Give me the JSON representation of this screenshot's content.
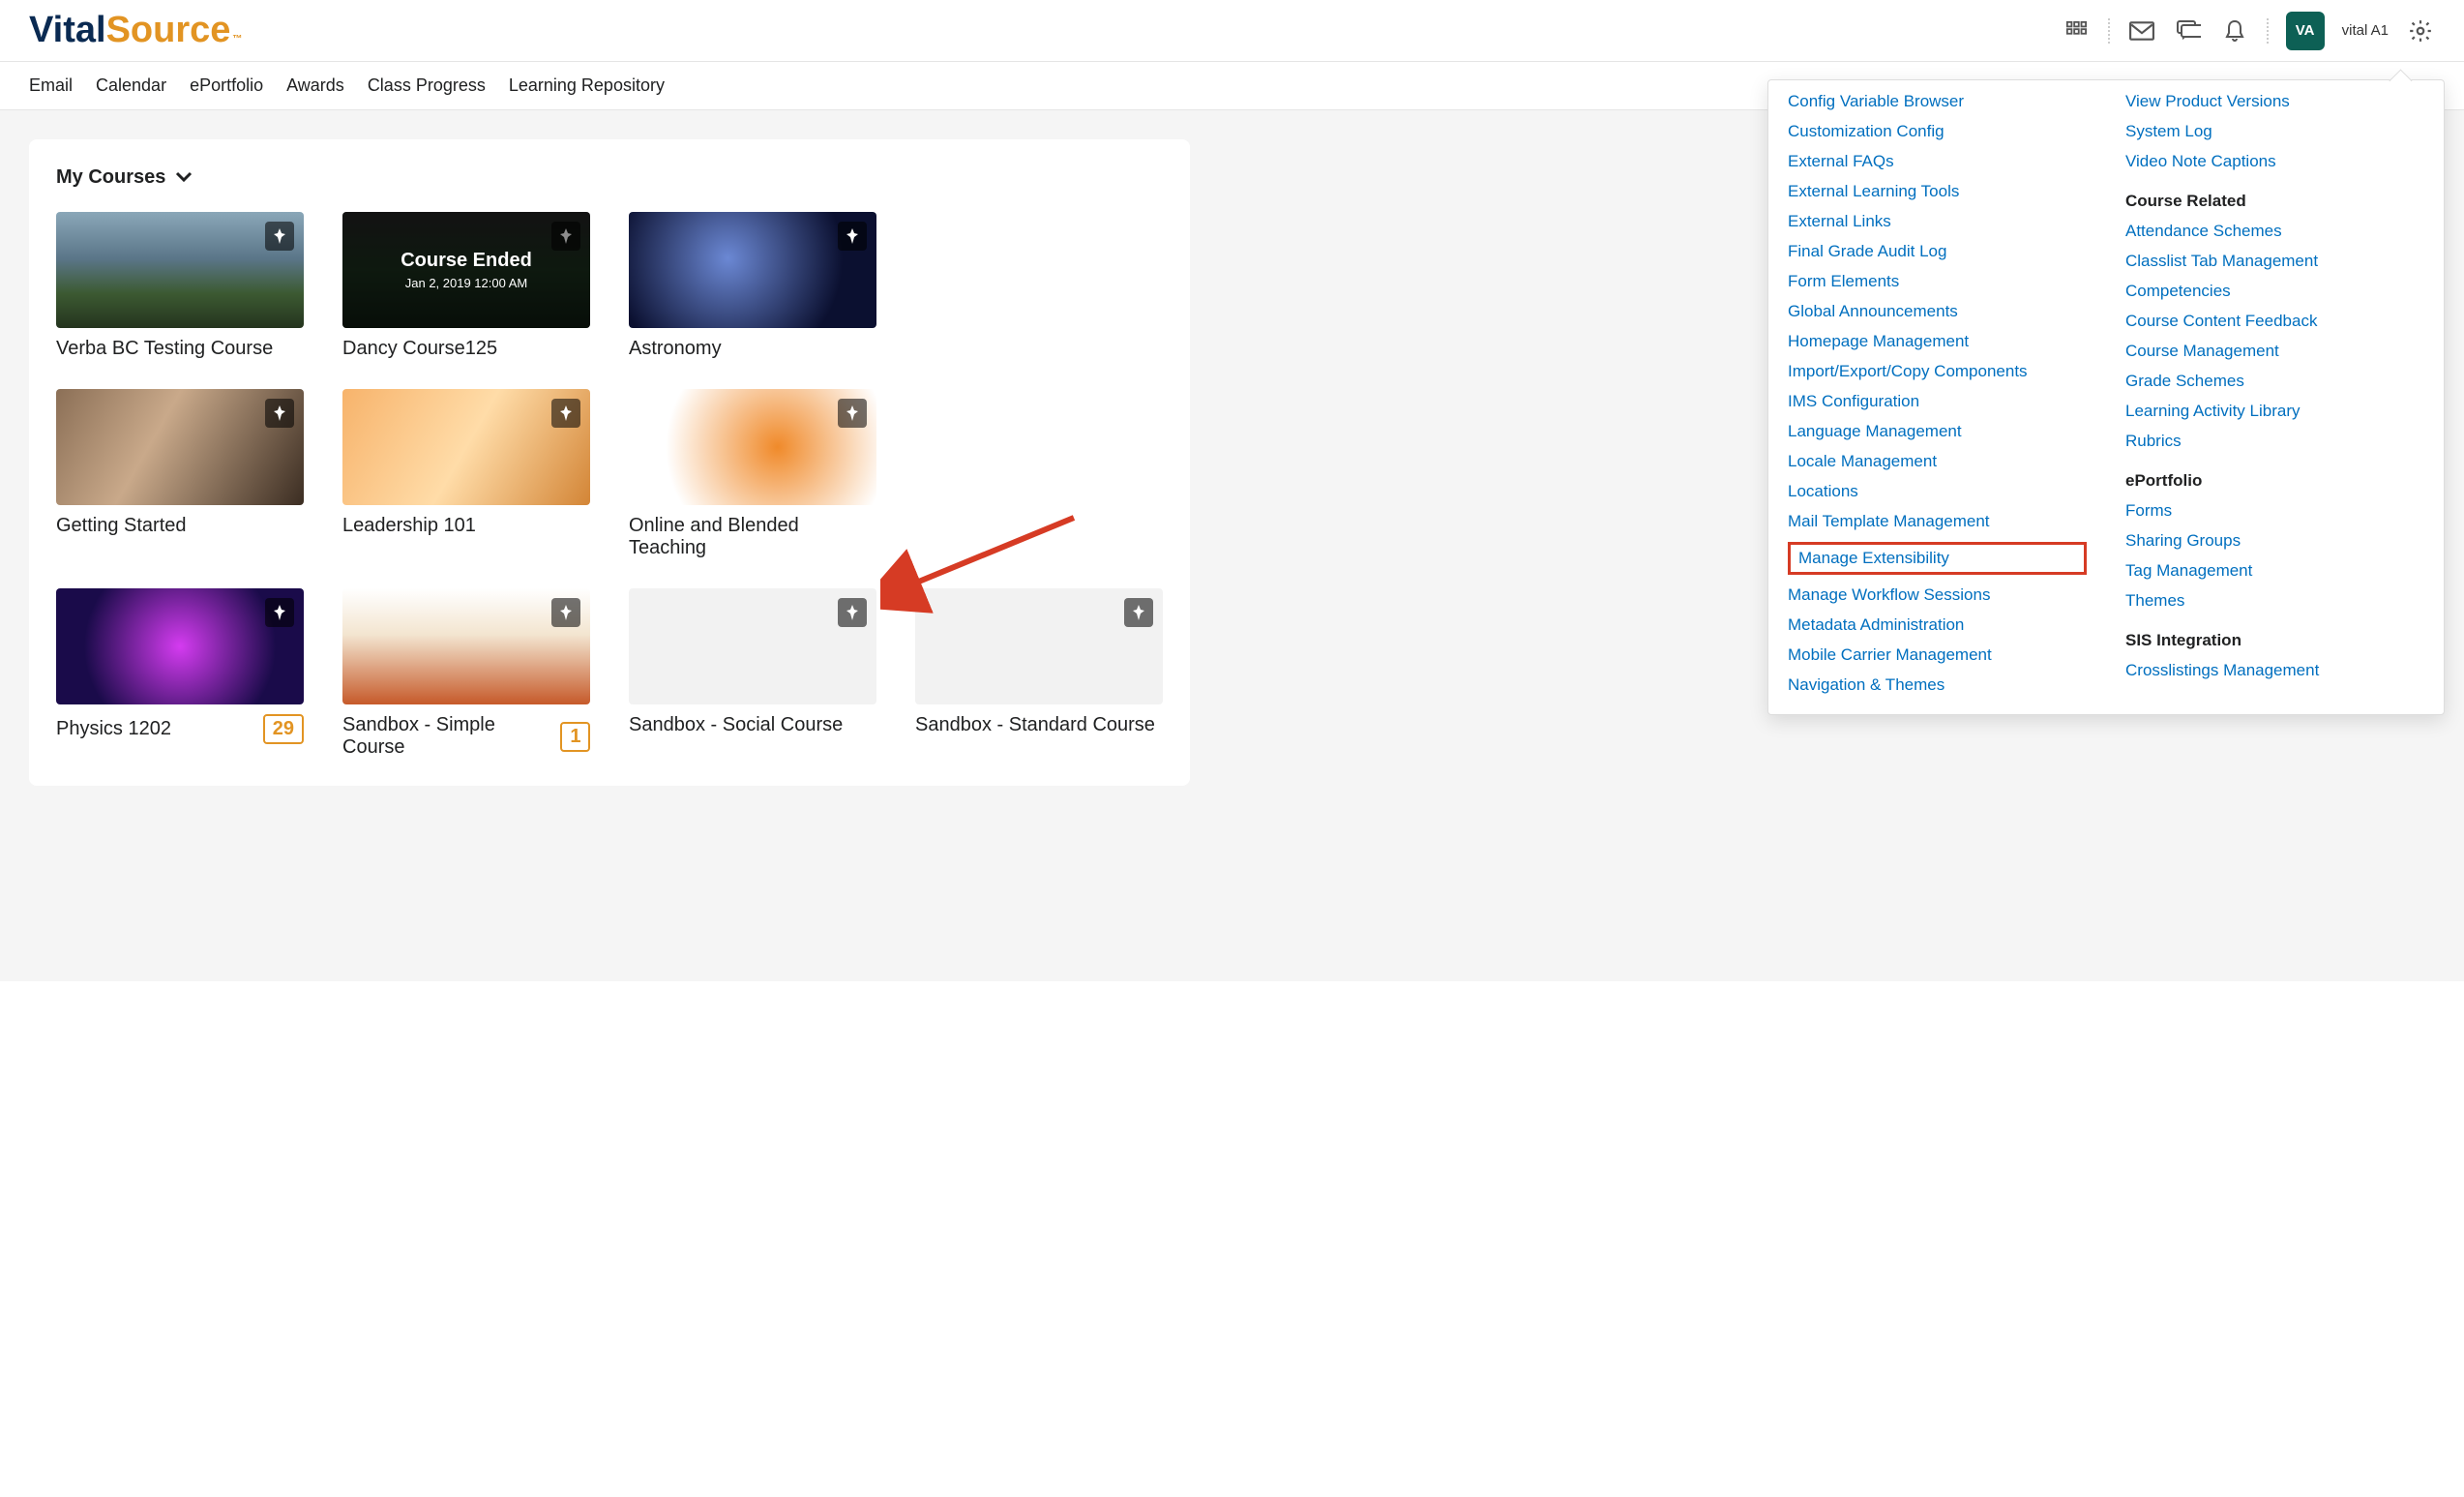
{
  "brand": {
    "part1": "Vital",
    "part2": "Source",
    "tm": "™"
  },
  "user": {
    "initials": "VA",
    "name": "vital A1"
  },
  "nav": {
    "items": [
      "Email",
      "Calendar",
      "ePortfolio",
      "Awards",
      "Class Progress",
      "Learning Repository"
    ]
  },
  "panel": {
    "title": "My Courses"
  },
  "courses": [
    {
      "title": "Verba BC Testing Course",
      "badge": null,
      "overlay": null
    },
    {
      "title": "Dancy Course125",
      "badge": null,
      "overlay": {
        "title": "Course Ended",
        "sub": "Jan 2, 2019 12:00 AM"
      }
    },
    {
      "title": "Astronomy",
      "badge": null,
      "overlay": null
    },
    {
      "title": "",
      "badge": null,
      "overlay": null
    },
    {
      "title": "Getting Started",
      "badge": null,
      "overlay": null
    },
    {
      "title": "Leadership 101",
      "badge": null,
      "overlay": null
    },
    {
      "title": "Online and Blended Teaching",
      "badge": null,
      "overlay": null
    },
    {
      "title": "",
      "badge": null,
      "overlay": null
    },
    {
      "title": "Physics 1202",
      "badge": "29",
      "overlay": null
    },
    {
      "title": "Sandbox - Simple Course",
      "badge": "1",
      "overlay": null
    },
    {
      "title": "Sandbox - Social Course",
      "badge": null,
      "overlay": null
    },
    {
      "title": "Sandbox - Standard Course",
      "badge": null,
      "overlay": null
    }
  ],
  "settings": {
    "col1": [
      "Config Variable Browser",
      "Customization Config",
      "External FAQs",
      "External Learning Tools",
      "External Links",
      "Final Grade Audit Log",
      "Form Elements",
      "Global Announcements",
      "Homepage Management",
      "Import/Export/Copy Components",
      "IMS Configuration",
      "Language Management",
      "Locale Management",
      "Locations",
      "Mail Template Management",
      "Manage Extensibility",
      "Manage Workflow Sessions",
      "Metadata Administration",
      "Mobile Carrier Management",
      "Navigation & Themes"
    ],
    "col2_top": [
      "View Product Versions",
      "System Log",
      "Video Note Captions"
    ],
    "col2_sections": [
      {
        "heading": "Course Related",
        "links": [
          "Attendance Schemes",
          "Classlist Tab Management",
          "Competencies",
          "Course Content Feedback",
          "Course Management",
          "Grade Schemes",
          "Learning Activity Library",
          "Rubrics"
        ]
      },
      {
        "heading": "ePortfolio",
        "links": [
          "Forms",
          "Sharing Groups",
          "Tag Management",
          "Themes"
        ]
      },
      {
        "heading": "SIS Integration",
        "links": [
          "Crosslistings Management"
        ]
      }
    ],
    "highlight_index": 15
  }
}
